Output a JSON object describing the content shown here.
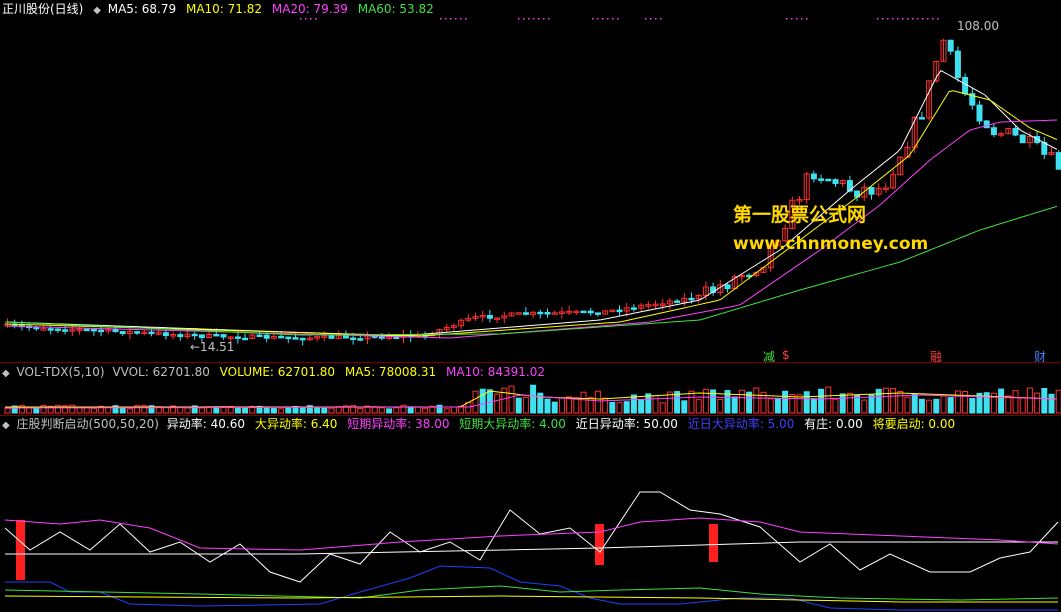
{
  "main_panel": {
    "stock_name": "正川股份(日线)",
    "indicators": [
      {
        "label": "MA5: 68.79",
        "color": "#ffffff"
      },
      {
        "label": "MA10: 71.82",
        "color": "#ffff00"
      },
      {
        "label": "MA20: 79.39",
        "color": "#ff40ff"
      },
      {
        "label": "MA60: 53.82",
        "color": "#40e040"
      }
    ],
    "high_price_label": "108.00",
    "low_price_label": "←14.51",
    "watermark_cn": "第一股票公式网",
    "watermark_en": "www.chnmoney.com",
    "event_tags": [
      {
        "label": "减",
        "color": "#40e040"
      },
      {
        "label": "$",
        "color": "#ff4040"
      },
      {
        "label": "融",
        "color": "#ff4040"
      },
      {
        "label": "财",
        "color": "#4080ff"
      }
    ]
  },
  "volume_panel": {
    "title": "VOL-TDX(5,10)",
    "items": [
      {
        "label": "VVOL: 62701.80",
        "color": "#c0c0c0"
      },
      {
        "label": "VOLUME: 62701.80",
        "color": "#ffff00"
      },
      {
        "label": "MA5: 78008.31",
        "color": "#ffff00"
      },
      {
        "label": "MA10: 84391.02",
        "color": "#ff40ff"
      }
    ]
  },
  "indicator_panel": {
    "title": "庄股判断启动(500,50,20)",
    "items": [
      {
        "label": "异动率: 40.60",
        "color": "#ffffff"
      },
      {
        "label": "大异动率: 6.40",
        "color": "#ffff00"
      },
      {
        "label": "短期异动率: 38.00",
        "color": "#ff40ff"
      },
      {
        "label": "短期大异动率: 4.00",
        "color": "#40e040"
      },
      {
        "label": "近日异动率: 50.00",
        "color": "#ffffff"
      },
      {
        "label": "近日大异动率: 5.00",
        "color": "#4040ff"
      },
      {
        "label": "有庄: 0.00",
        "color": "#ffffff"
      },
      {
        "label": "将要启动: 0.00",
        "color": "#ffff00"
      }
    ]
  },
  "chart_data": {
    "type": "candlestick",
    "title": "正川股份(日线)",
    "price_high": 108.0,
    "price_low": 14.51,
    "ma_latest": {
      "MA5": 68.79,
      "MA10": 71.82,
      "MA20": 79.39,
      "MA60": 53.82
    },
    "volume_latest": {
      "VOLUME": 62701.8,
      "MA5": 78008.31,
      "MA10": 84391.02
    }
  },
  "colors": {
    "up": "#ff3030",
    "down": "#40e0f0",
    "grid": "#7a0000",
    "background": "#000000"
  }
}
